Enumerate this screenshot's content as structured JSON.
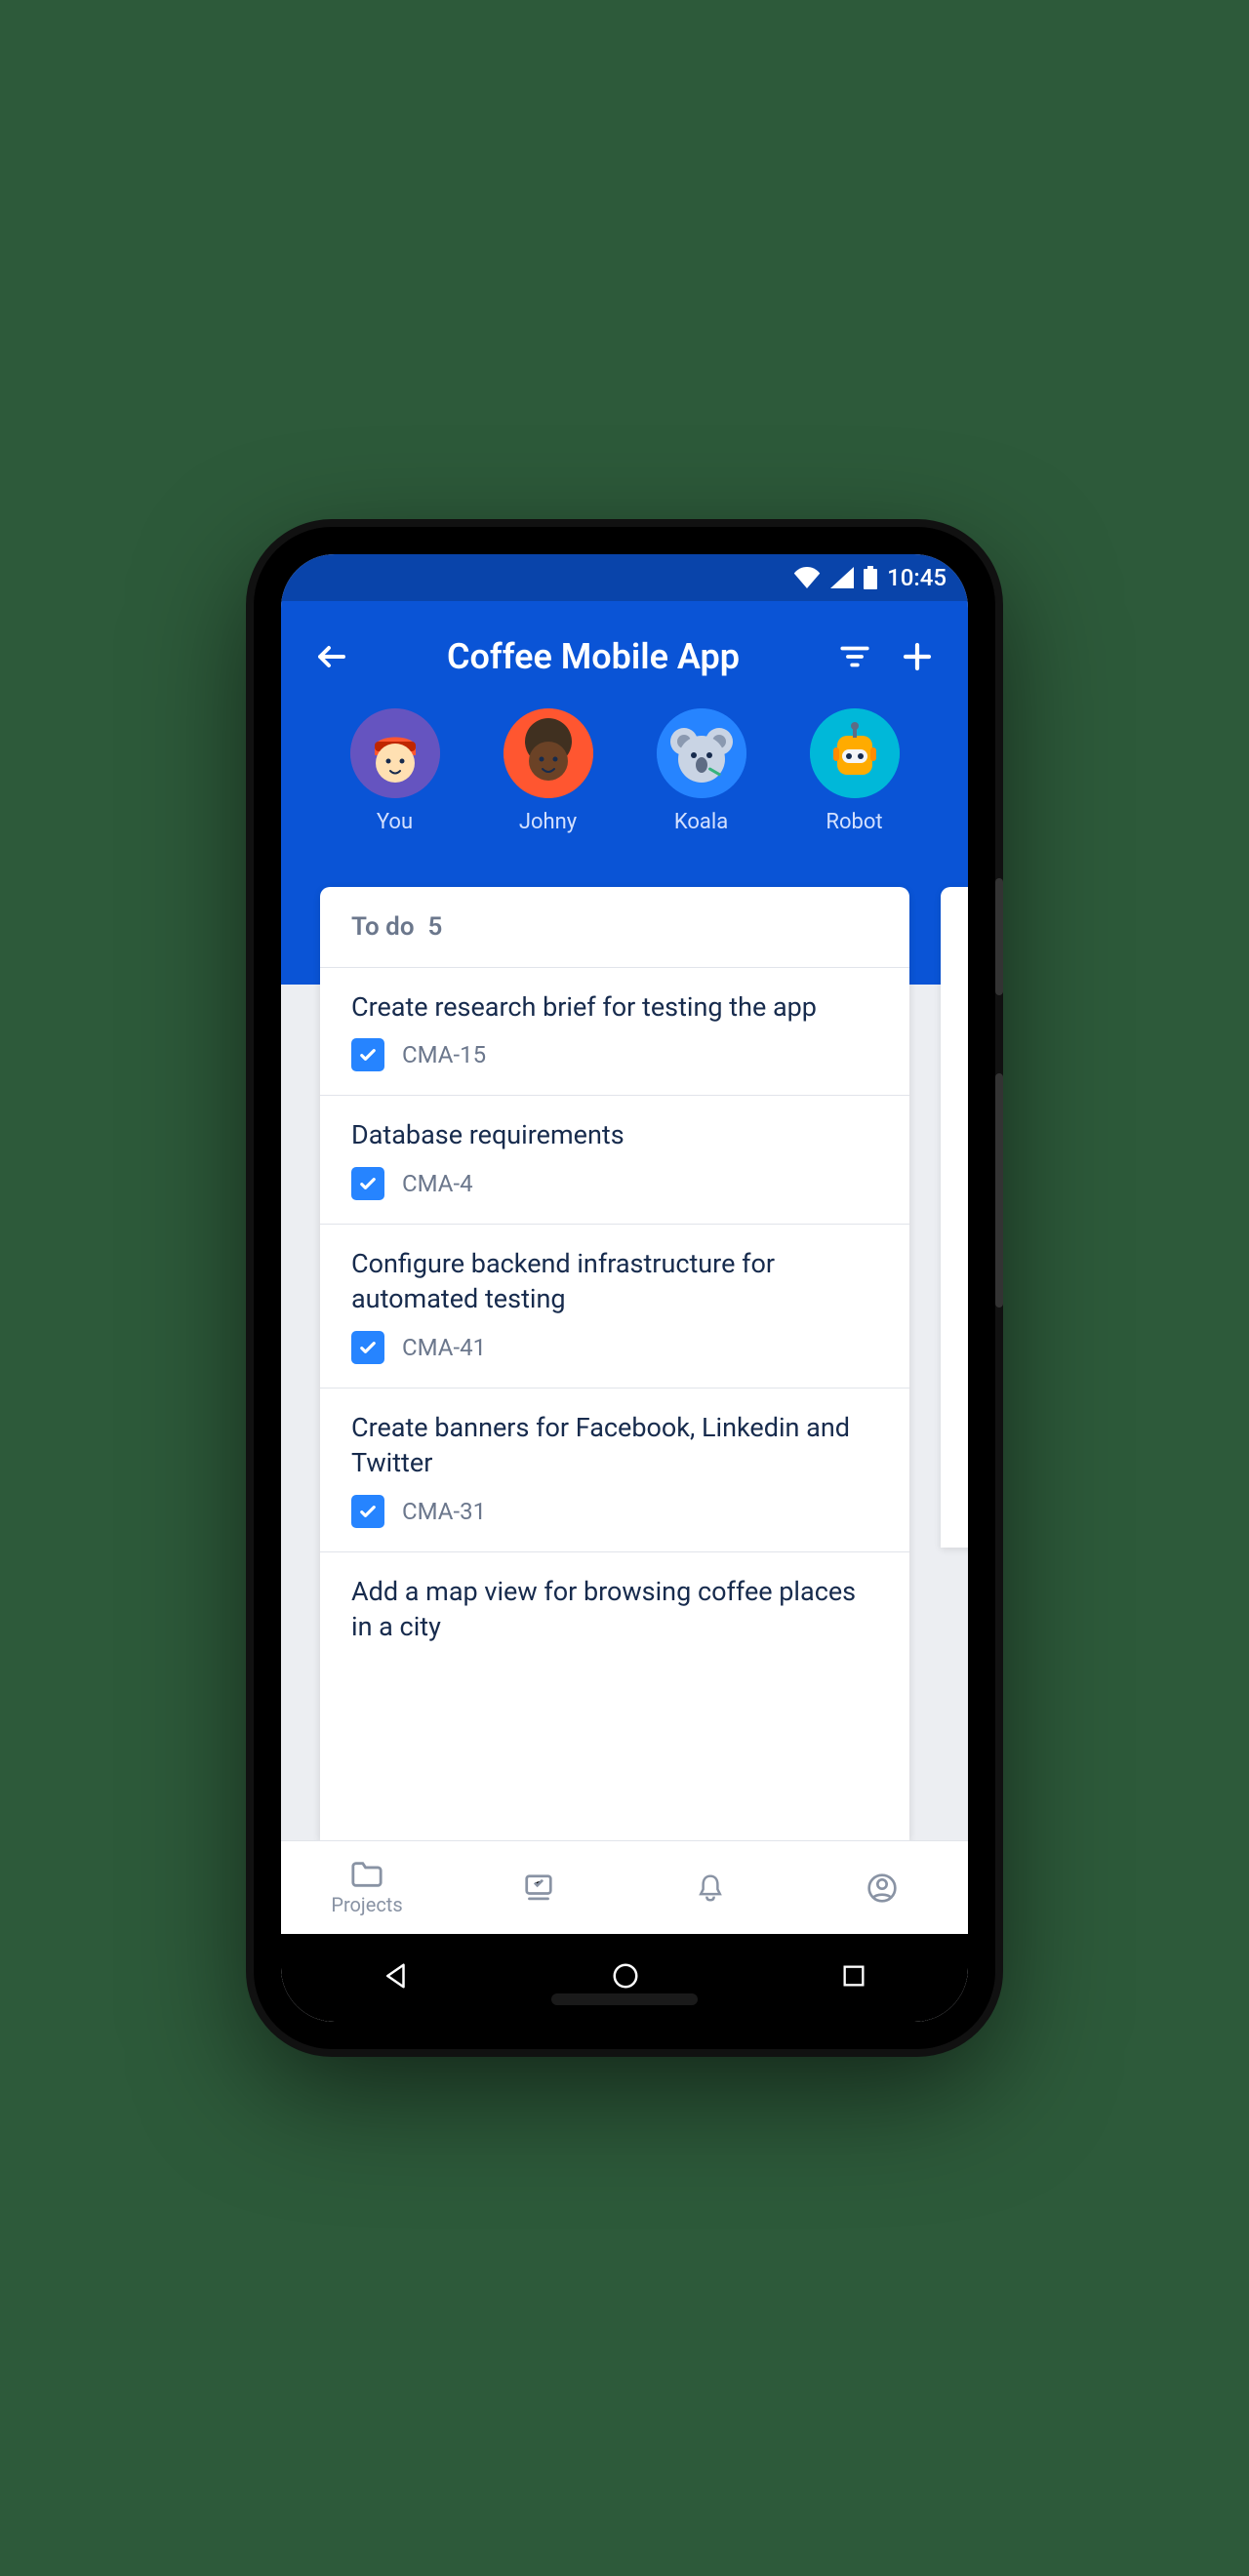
{
  "status": {
    "time": "10:45"
  },
  "header": {
    "title": "Coffee Mobile App",
    "assignees": [
      {
        "label": "You"
      },
      {
        "label": "Johny"
      },
      {
        "label": "Koala"
      },
      {
        "label": "Robot"
      }
    ]
  },
  "board": {
    "column_name": "To do",
    "column_count": "5",
    "cards": [
      {
        "title": "Create research brief for testing the app",
        "key": "CMA-15"
      },
      {
        "title": "Database requirements",
        "key": "CMA-4"
      },
      {
        "title": "Configure backend infrastructure for automated testing",
        "key": "CMA-41"
      },
      {
        "title": "Create banners for Facebook, Linkedin and Twitter",
        "key": "CMA-31"
      },
      {
        "title": "Add a map view for browsing coffee places in a city",
        "key": ""
      }
    ]
  },
  "tabs": {
    "projects": "Projects"
  },
  "colors": {
    "primary": "#0a54d6",
    "primary_dark": "#0944aa",
    "text": "#172b4d",
    "muted": "#6b778c",
    "issue_blue": "#2684ff"
  }
}
